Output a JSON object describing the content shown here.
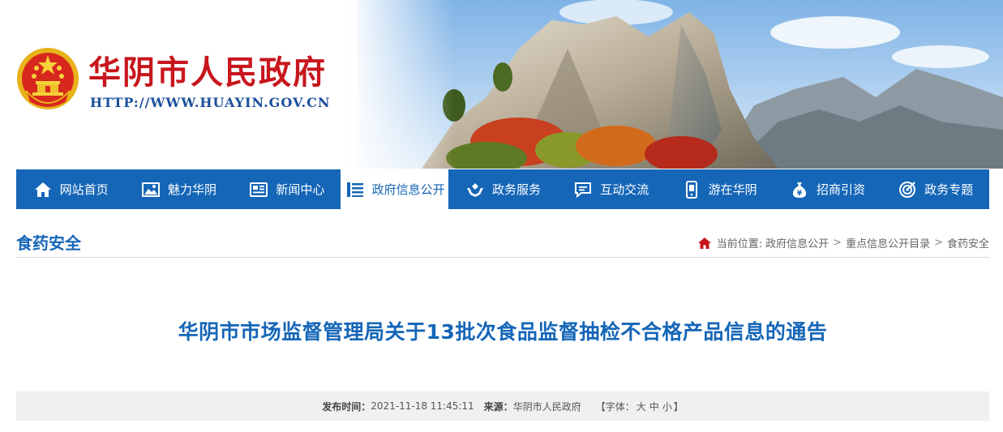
{
  "header": {
    "site_title": "华阴市人民政府",
    "site_url": "HTTP://WWW.HUAYIN.GOV.CN"
  },
  "nav": {
    "items": [
      {
        "label": "网站首页",
        "icon": "home-icon"
      },
      {
        "label": "魅力华阴",
        "icon": "picture-icon"
      },
      {
        "label": "新闻中心",
        "icon": "news-icon"
      },
      {
        "label": "政府信息公开",
        "icon": "list-icon",
        "active": true
      },
      {
        "label": "政务服务",
        "icon": "hands-service-icon"
      },
      {
        "label": "互动交流",
        "icon": "chat-icon"
      },
      {
        "label": "游在华阴",
        "icon": "phone-travel-icon"
      },
      {
        "label": "招商引资",
        "icon": "money-bag-icon"
      },
      {
        "label": "政务专题",
        "icon": "target-icon"
      }
    ]
  },
  "section": {
    "title": "食药安全",
    "breadcrumb": {
      "prefix": "当前位置:",
      "items": [
        "政府信息公开",
        "重点信息公开目录",
        "食药安全"
      ],
      "separator": ">"
    }
  },
  "article": {
    "title": "华阴市市场监督管理局关于13批次食品监督抽检不合格产品信息的通告",
    "publish_label": "发布时间：",
    "publish_time": "2021-11-18 11:45:11",
    "source_label": "来源：",
    "source": "华阴市人民政府",
    "font_size_label": "【字体：",
    "font_size_options": [
      "大",
      "中",
      "小"
    ],
    "font_size_close": "】"
  },
  "colors": {
    "nav_bg": "#1566b7",
    "title_red": "#c8161d",
    "accent_blue": "#1566b7"
  }
}
